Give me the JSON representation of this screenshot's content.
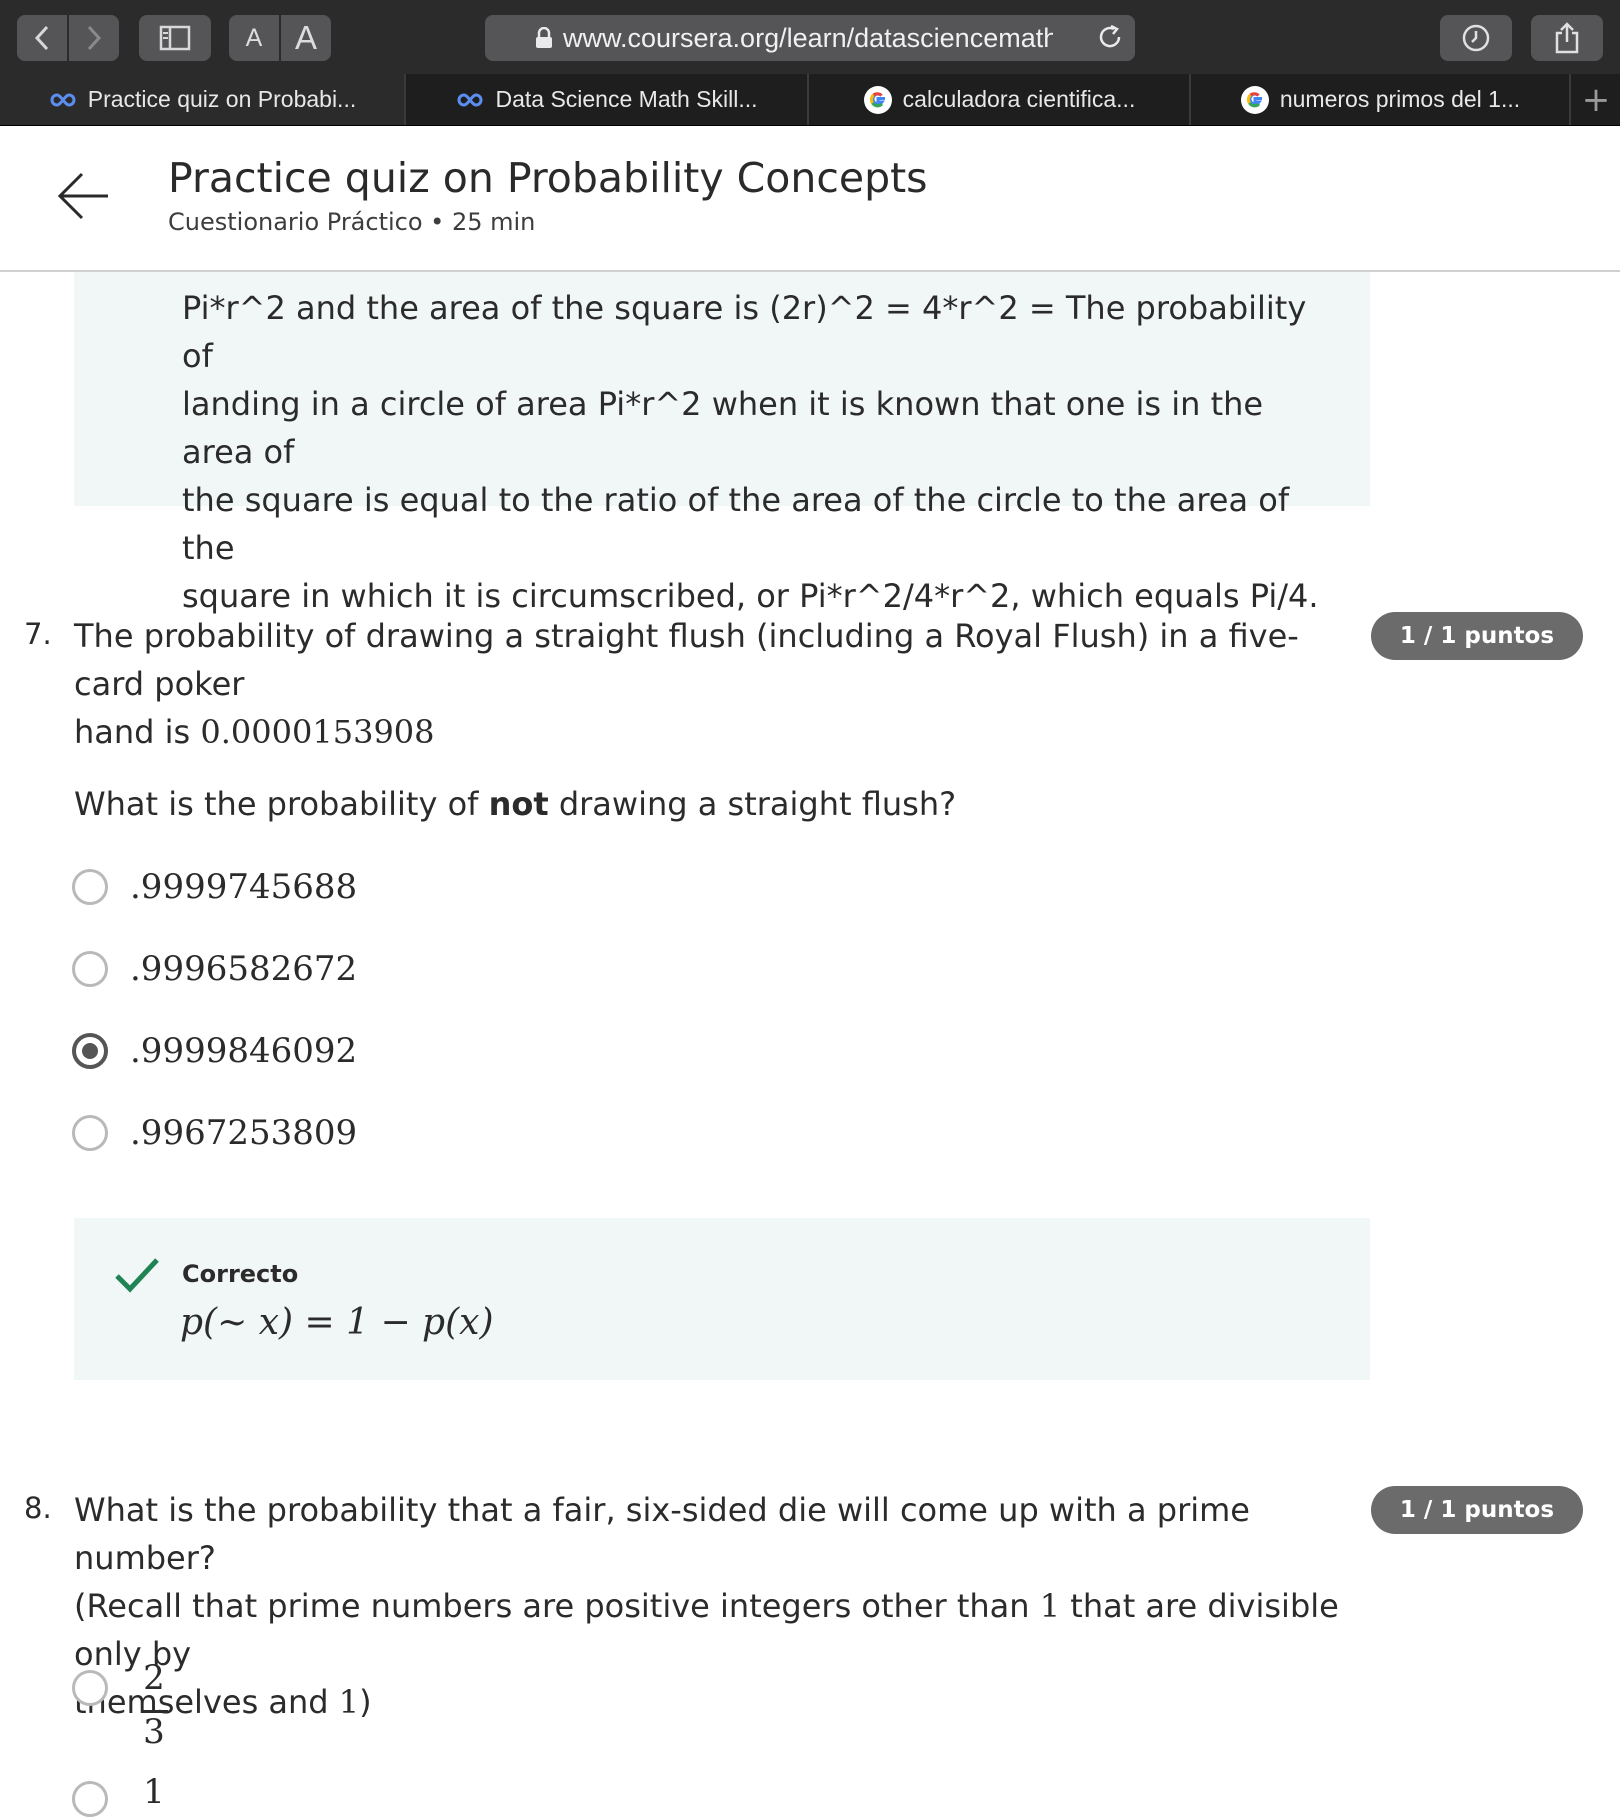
{
  "browser": {
    "url": "www.coursera.org/learn/datasciencemathskil",
    "text_size_small": "A",
    "text_size_large": "A",
    "tabs": [
      {
        "label": "Practice quiz on Probabi...",
        "icon": "coursera-icon",
        "active": true
      },
      {
        "label": "Data Science Math Skill...",
        "icon": "coursera-icon",
        "active": false
      },
      {
        "label": "calculadora cientifica...",
        "icon": "google-icon",
        "active": false
      },
      {
        "label": "numeros primos del 1...",
        "icon": "google-icon",
        "active": false
      }
    ],
    "new_tab": "+"
  },
  "header": {
    "title": "Practice quiz on Probability Concepts",
    "subtitle": "Cuestionario Práctico • 25 min"
  },
  "q6_feedback": {
    "lines": [
      "Pi*r^2 and the area of the square is (2r)^2 = 4*r^2 = The probability of",
      "landing in a circle of area Pi*r^2 when it is known that one is in the area of",
      "the square is equal to the ratio of the area of the circle to the area of the",
      "square in which it is circumscribed, or Pi*r^2/4*r^2, which equals Pi/4."
    ]
  },
  "q7": {
    "number": "7.",
    "text_a": "The probability of drawing a straight flush (including a Royal Flush) in a five-card poker",
    "text_b_prefix": "hand is ",
    "text_b_value": "0.0000153908",
    "prompt_before": "What is the probability of ",
    "prompt_bold": "not",
    "prompt_after": " drawing a straight flush?",
    "points": "1 / 1 puntos",
    "options": [
      ".9999745688",
      ".9996582672",
      ".9999846092",
      ".9967253809"
    ],
    "selected_index": 2,
    "feedback_status": "Correcto",
    "feedback_formula": "p(∼ x) = 1 − p(x)"
  },
  "q8": {
    "number": "8.",
    "line1": "What is the probability that a fair, six-sided die will come up with a prime number?",
    "line2_a": "(Recall that prime numbers are positive integers other than ",
    "line2_one": "1",
    "line2_b": " that are divisible only by",
    "line3_a": "themselves and ",
    "line3_one": "1",
    "line3_b": ")",
    "points": "1 / 1 puntos",
    "option1_num": "2",
    "option1_den": "3",
    "option2_num": "1"
  },
  "colors": {
    "toolbar": "#2b2b2c",
    "feedback_bg": "#f1f7f6",
    "badge": "#6b6b6b",
    "check": "#1f8354"
  }
}
